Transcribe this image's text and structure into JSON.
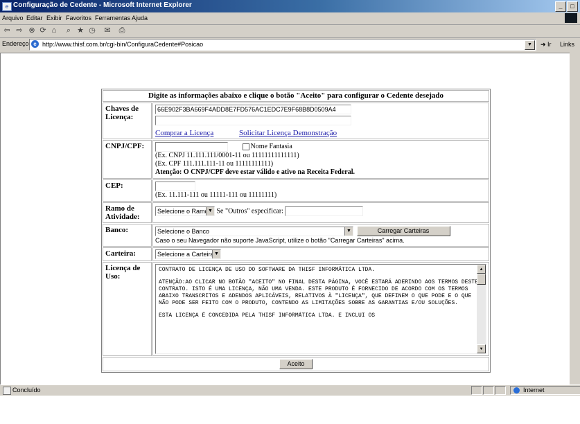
{
  "window": {
    "title": "Configuração de Cedente - Microsoft Internet Explorer",
    "controls": [
      "_",
      "□"
    ]
  },
  "menu": [
    "Arquivo",
    "Editar",
    "Exibir",
    "Favoritos",
    "Ferramentas",
    "Ajuda"
  ],
  "toolbar_icons": [
    "back-icon",
    "forward-icon",
    "stop-icon",
    "refresh-icon",
    "home-icon",
    "search-icon",
    "favorites-icon",
    "history-icon",
    "mail-icon",
    "print-icon"
  ],
  "address": {
    "label": "Endereço",
    "url": "http://www.thisf.com.br/cgi-bin/ConfiguraCedente#Posicao",
    "go": "Ir",
    "links": "Links"
  },
  "status": {
    "text": "Concluído",
    "zone": "Internet"
  },
  "form": {
    "header": "Digite as informações abaixo e clique o botão \"Aceito\" para configurar o Cedente desejado",
    "license_keys": {
      "label": "Chaves de Licença:",
      "key1": "66E902F3BA669F4ADD8E7FD576AC1EDC7E9F68B8D0509A4",
      "key2": "",
      "buy_link": "Comprar a Licença",
      "demo_link": "Solicitar Licença Demonstração"
    },
    "cnpj": {
      "label": "CNPJ/CPF:",
      "value": "",
      "fantasy_checkbox": "Nome Fantasia",
      "ex1": "(Ex. CNPJ 11.111.111/0001-11 ou 11111111111111)",
      "ex2": "(Ex. CPF 111.111.111-11 ou 11111111111)",
      "warning": "Atenção: O CNPJ/CPF deve estar válido e ativo na Receita Federal."
    },
    "cep": {
      "label": "CEP:",
      "value": "",
      "ex": "(Ex. 11.111-111 ou 11111-111 ou 11111111)"
    },
    "ramo": {
      "label": "Ramo de Atividade:",
      "select": "Selecione o Ramo",
      "other_label": "Se \"Outros\" especificar:",
      "other_value": ""
    },
    "banco": {
      "label": "Banco:",
      "select": "Selecione o Banco",
      "button": "Carregar Carteiras",
      "note": "Caso o seu Navegador não suporte JavaScript, utilize o botão \"Carregar Carteiras\" acima."
    },
    "carteira": {
      "label": "Carteira:",
      "select": "Selecione a Carteira"
    },
    "license_text": {
      "label": "Licença de Uso:",
      "p1": "CONTRATO DE LICENÇA DE USO DO SOFTWARE DA THISF INFORMÁTICA LTDA.",
      "p2": "ATENÇÃO:AO CLICAR NO BOTÃO \"ACEITO\" NO FINAL DESTA PÁGINA, VOCÊ ESTARÁ ADERINDO AOS TERMOS DESTE CONTRATO. ISTO É UMA LICENÇA, NÃO UMA VENDA. ESTE PRODUTO É FORNECIDO DE ACORDO COM OS TERMOS ABAIXO TRANSCRITOS E ADENDOS APLICÁVEIS, RELATIVOS À \"LICENÇA\", QUE DEFINEM O QUE PODE E O QUE NÃO PODE SER FEITO COM O PRODUTO, CONTENDO AS LIMITAÇÕES SOBRE AS GARANTIAS E/OU SOLUÇÕES.",
      "p3": "ESTA LICENÇA É CONCEDIDA PELA THISF INFORMÁTICA LTDA. E INCLUI OS"
    },
    "accept_button": "Aceito"
  }
}
